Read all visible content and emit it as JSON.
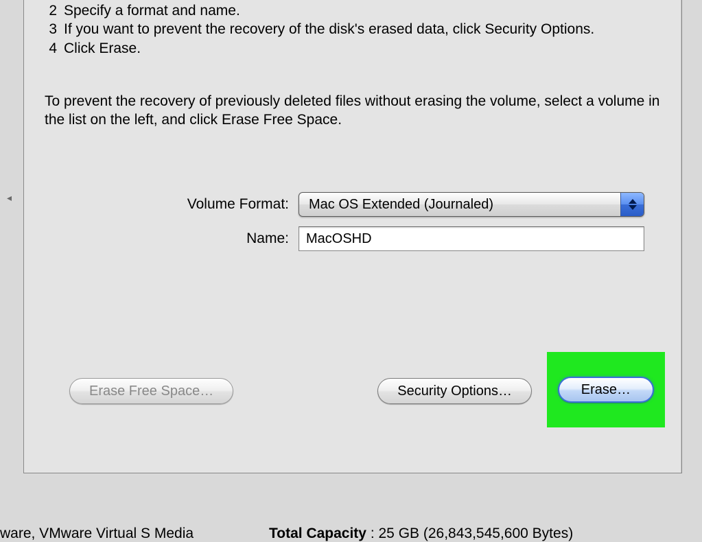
{
  "instructions": {
    "steps": [
      {
        "num": "2",
        "text": "Specify a format and name."
      },
      {
        "num": "3",
        "text": "If you want to prevent the recovery of the disk's erased data, click Security Options."
      },
      {
        "num": "4",
        "text": "Click Erase."
      }
    ],
    "paragraph": "To prevent the recovery of previously deleted files without erasing the volume, select a volume in the list on the left, and click Erase Free Space."
  },
  "form": {
    "format_label": "Volume Format:",
    "format_value": "Mac OS Extended (Journaled)",
    "name_label": "Name:",
    "name_value": "MacOSHD"
  },
  "buttons": {
    "erase_free_space": "Erase Free Space…",
    "security_options": "Security Options…",
    "erase": "Erase…"
  },
  "footer": {
    "left_text": "ware, VMware Virtual S Media",
    "capacity_label": "Total Capacity",
    "capacity_value": ": 25 GB (26,843,545,600 Bytes)"
  }
}
